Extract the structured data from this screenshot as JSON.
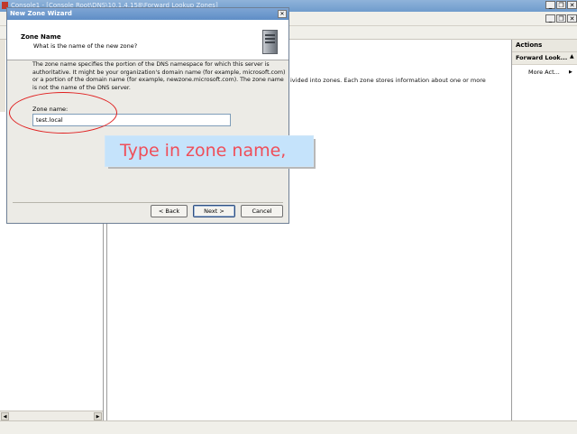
{
  "window": {
    "title": "Console1 - [Console Root\\DNS\\10.1.4.158\\Forward Lookup Zones]",
    "minimize": "_",
    "restore": "❐",
    "close": "✕"
  },
  "background": {
    "center_text": "ivided into zones. Each zone stores information about one or more"
  },
  "actions_pane": {
    "header": "Actions",
    "section": "Forward Look...",
    "section_arrow": "▲",
    "more": "More Act...",
    "more_arrow": "▶"
  },
  "wizard": {
    "title": "New Zone Wizard",
    "close": "✕",
    "heading": "Zone Name",
    "subheading": "What is the name of the new zone?",
    "description": "The zone name specifies the portion of the DNS namespace for which this server is authoritative. It might be your organization's domain name (for example, microsoft.com) or a portion of the domain name (for example, newzone.microsoft.com). The zone name is not the name of the DNS server.",
    "zone_name_label": "Zone name:",
    "zone_name_value": "test.local",
    "buttons": {
      "back": "< Back",
      "next": "Next >",
      "cancel": "Cancel"
    }
  },
  "annotation": {
    "text": "Type in zone name,",
    "color": "#ef4e59",
    "background": "#c5e3fb"
  },
  "scroll": {
    "left": "◀",
    "right": "▶"
  }
}
